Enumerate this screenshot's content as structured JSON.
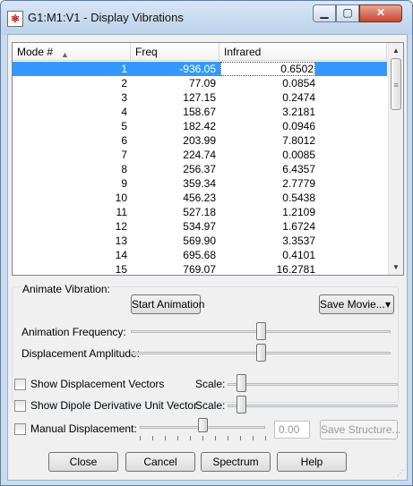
{
  "window": {
    "title": "G1:M1:V1 - Display Vibrations",
    "minimize_icon": "minimize-icon",
    "maximize_icon": "maximize-icon",
    "close_icon": "close-icon",
    "minimize_glyph": "▁",
    "maximize_glyph": "▢",
    "close_glyph": "✕"
  },
  "table": {
    "headers": [
      "Mode #",
      "Freq",
      "Infrared"
    ],
    "sort_indicator": "▲",
    "rows": [
      {
        "mode": "1",
        "freq": "-936.05",
        "ir": "0.6502"
      },
      {
        "mode": "2",
        "freq": "77.09",
        "ir": "0.0854"
      },
      {
        "mode": "3",
        "freq": "127.15",
        "ir": "0.2474"
      },
      {
        "mode": "4",
        "freq": "158.67",
        "ir": "3.2181"
      },
      {
        "mode": "5",
        "freq": "182.42",
        "ir": "0.0946"
      },
      {
        "mode": "6",
        "freq": "203.99",
        "ir": "7.8012"
      },
      {
        "mode": "7",
        "freq": "224.74",
        "ir": "0.0085"
      },
      {
        "mode": "8",
        "freq": "256.37",
        "ir": "6.4357"
      },
      {
        "mode": "9",
        "freq": "359.34",
        "ir": "2.7779"
      },
      {
        "mode": "10",
        "freq": "456.23",
        "ir": "0.5438"
      },
      {
        "mode": "11",
        "freq": "527.18",
        "ir": "1.2109"
      },
      {
        "mode": "12",
        "freq": "534.97",
        "ir": "1.6724"
      },
      {
        "mode": "13",
        "freq": "569.90",
        "ir": "3.3537"
      },
      {
        "mode": "14",
        "freq": "695.68",
        "ir": "0.4101"
      },
      {
        "mode": "15",
        "freq": "769.07",
        "ir": "16.2781"
      }
    ],
    "selected_row": 1,
    "selection_color": "#3399ff"
  },
  "animate": {
    "group_label": "Animate Vibration:",
    "start_button": "Start Animation",
    "save_movie_button": "Save Movie...",
    "save_movie_arrow": "▾",
    "frequency_label": "Animation Frequency:",
    "frequency_level": 0.5,
    "amplitude_label": "Displacement Amplitude:",
    "amplitude_level": 0.5
  },
  "options": {
    "show_vectors_label": "Show Displacement Vectors",
    "show_vectors_checked": false,
    "vectors_scale_label": "Scale:",
    "vectors_scale_level": 0.08,
    "show_dipole_label": "Show Dipole Derivative Unit Vector",
    "show_dipole_checked": false,
    "dipole_scale_label": "Scale:",
    "dipole_scale_level": 0.08,
    "manual_label": "Manual Displacement:",
    "manual_checked": false,
    "manual_level": 0.5,
    "manual_value": "0.00",
    "save_structure_button": "Save Structure..."
  },
  "footer": {
    "close_button": "Close",
    "cancel_button": "Cancel",
    "spectrum_button": "Spectrum",
    "help_button": "Help"
  }
}
